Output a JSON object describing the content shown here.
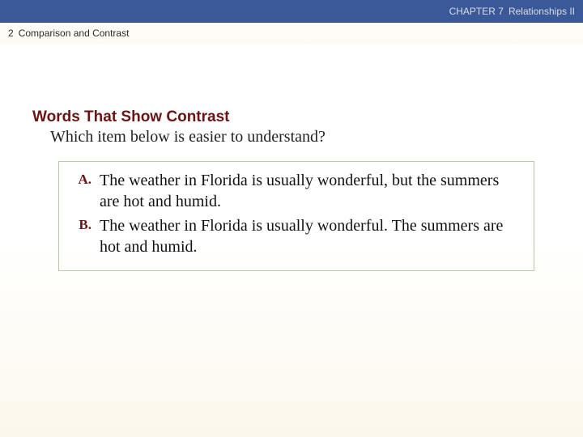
{
  "header": {
    "chapter": "CHAPTER 7",
    "title": "Relationships II"
  },
  "subheader": {
    "number": "2",
    "topic": "Comparison and Contrast"
  },
  "content": {
    "heading": "Words That Show Contrast",
    "question": "Which item below is easier to understand?",
    "options": [
      {
        "label": "A.",
        "text": "The weather in Florida is usually wonderful, but the summers are hot and humid."
      },
      {
        "label": "B.",
        "text": "The weather in Florida is usually wonderful. The summers are hot and humid."
      }
    ]
  }
}
